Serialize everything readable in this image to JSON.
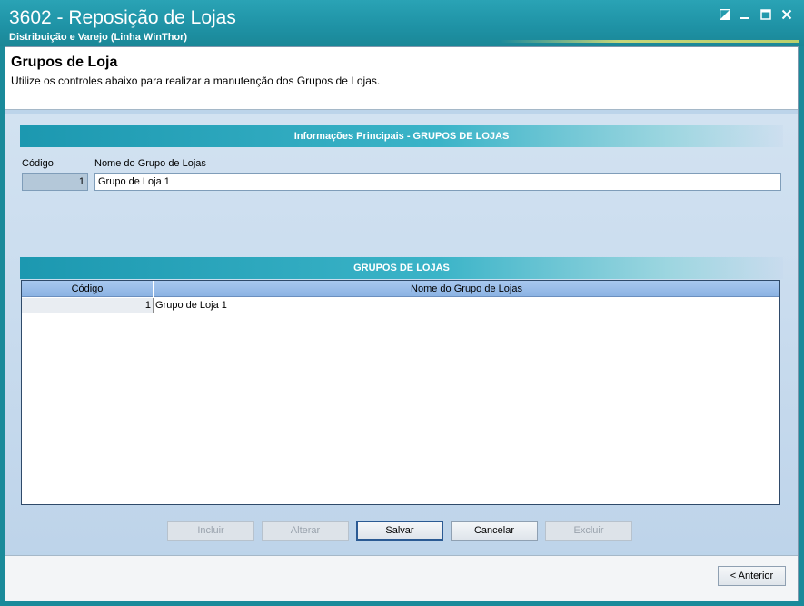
{
  "window": {
    "title": "3602 - Reposição de Lojas",
    "subtitle": "Distribuição e Varejo (Linha WinThor)",
    "controls": [
      "restore-down-icon",
      "minimize-icon",
      "maximize-icon",
      "close-icon"
    ]
  },
  "header": {
    "title": "Grupos de Loja",
    "description": "Utilize os controles abaixo para realizar a manutenção dos Grupos de Lojas."
  },
  "main_section": {
    "title": "Informações Principais - GRUPOS DE LOJAS",
    "code_label": "Código",
    "name_label": "Nome do Grupo de Lojas",
    "code_value": "1",
    "name_value": "Grupo de Loja 1"
  },
  "grid_section": {
    "title": "GRUPOS DE LOJAS",
    "columns": [
      "Código",
      "Nome do Grupo de Lojas"
    ],
    "rows": [
      {
        "code": "1",
        "name": "Grupo de Loja 1"
      }
    ]
  },
  "actions": {
    "include": "Incluir",
    "alter": "Alterar",
    "save": "Salvar",
    "cancel": "Cancelar",
    "delete": "Excluir"
  },
  "footer": {
    "previous": "< Anterior"
  },
  "colors": {
    "titlebar": "#1f93a6",
    "section_bar": "#1c98b0",
    "client_bg": "#bcd4ea",
    "grid_header": "#8cb3e3"
  }
}
